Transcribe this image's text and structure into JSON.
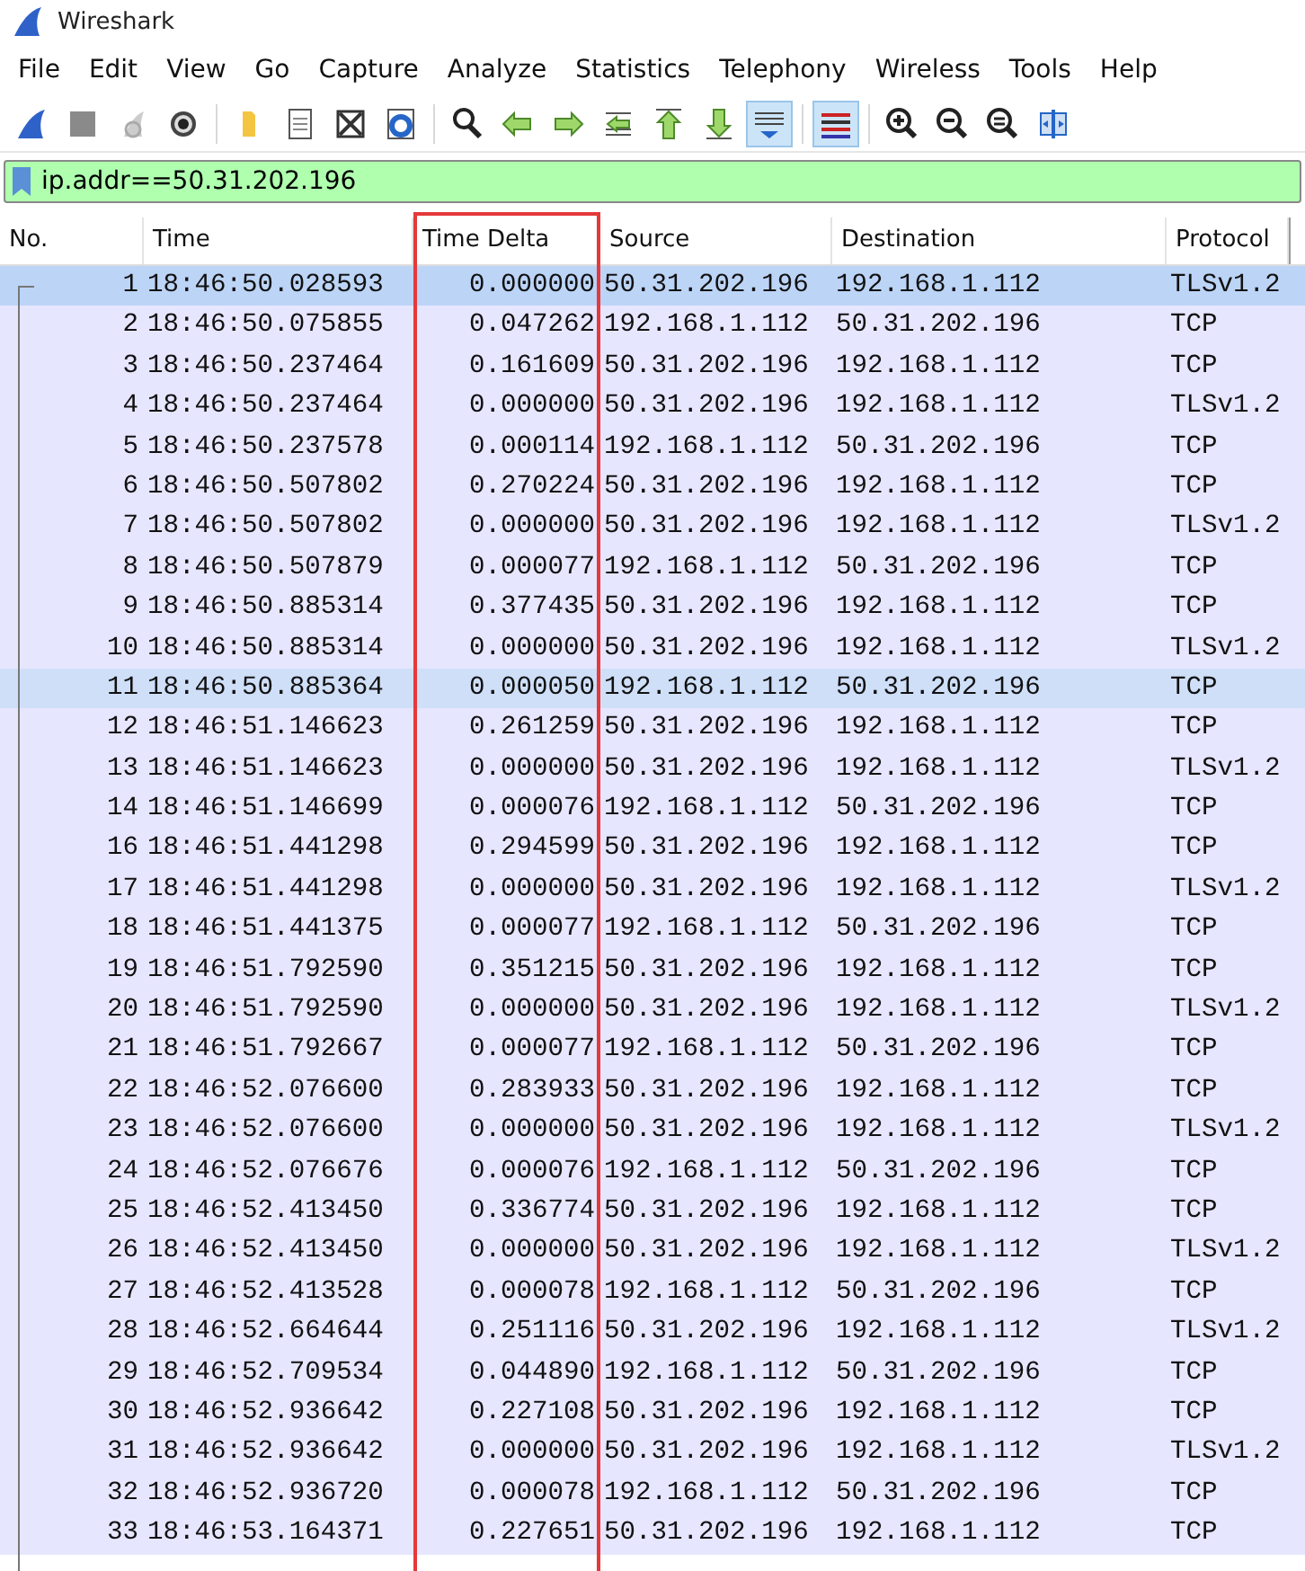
{
  "window": {
    "title": "Wireshark"
  },
  "menu": [
    "File",
    "Edit",
    "View",
    "Go",
    "Capture",
    "Analyze",
    "Statistics",
    "Telephony",
    "Wireless",
    "Tools",
    "Help"
  ],
  "toolbar": [
    [
      {
        "pressed": false
      },
      {
        "pressed": false
      },
      {
        "pressed": false
      },
      {
        "pressed": false
      }
    ],
    [
      {
        "pressed": false
      },
      {
        "pressed": false
      },
      {
        "pressed": false
      },
      {
        "pressed": false
      }
    ],
    [
      {
        "pressed": false
      },
      {
        "pressed": false
      },
      {
        "pressed": false
      },
      {
        "pressed": false
      },
      {
        "pressed": false
      },
      {
        "pressed": false
      },
      {
        "pressed": true
      }
    ],
    [
      {
        "pressed": true
      }
    ],
    [
      {
        "pressed": false
      },
      {
        "pressed": false
      },
      {
        "pressed": false
      },
      {
        "pressed": false
      }
    ]
  ],
  "filter": {
    "value": "ip.addr==50.31.202.196"
  },
  "table": {
    "columns": [
      {
        "label": "No.",
        "highlighted": false
      },
      {
        "label": "Time",
        "highlighted": false
      },
      {
        "label": "Time Delta",
        "highlighted": true
      },
      {
        "label": "Source",
        "highlighted": false
      },
      {
        "label": "Destination",
        "highlighted": false
      },
      {
        "label": "Protocol",
        "highlighted": false
      }
    ],
    "rows": [
      {
        "cells": [
          "1",
          "18:46:50.028593",
          "0.000000",
          "50.31.202.196",
          "192.168.1.112",
          "TLSv1.2"
        ],
        "selected": true,
        "hovered": false
      },
      {
        "cells": [
          "2",
          "18:46:50.075855",
          "0.047262",
          "192.168.1.112",
          "50.31.202.196",
          "TCP"
        ],
        "selected": false,
        "hovered": false
      },
      {
        "cells": [
          "3",
          "18:46:50.237464",
          "0.161609",
          "50.31.202.196",
          "192.168.1.112",
          "TCP"
        ],
        "selected": false,
        "hovered": false
      },
      {
        "cells": [
          "4",
          "18:46:50.237464",
          "0.000000",
          "50.31.202.196",
          "192.168.1.112",
          "TLSv1.2"
        ],
        "selected": false,
        "hovered": false
      },
      {
        "cells": [
          "5",
          "18:46:50.237578",
          "0.000114",
          "192.168.1.112",
          "50.31.202.196",
          "TCP"
        ],
        "selected": false,
        "hovered": false
      },
      {
        "cells": [
          "6",
          "18:46:50.507802",
          "0.270224",
          "50.31.202.196",
          "192.168.1.112",
          "TCP"
        ],
        "selected": false,
        "hovered": false
      },
      {
        "cells": [
          "7",
          "18:46:50.507802",
          "0.000000",
          "50.31.202.196",
          "192.168.1.112",
          "TLSv1.2"
        ],
        "selected": false,
        "hovered": false
      },
      {
        "cells": [
          "8",
          "18:46:50.507879",
          "0.000077",
          "192.168.1.112",
          "50.31.202.196",
          "TCP"
        ],
        "selected": false,
        "hovered": false
      },
      {
        "cells": [
          "9",
          "18:46:50.885314",
          "0.377435",
          "50.31.202.196",
          "192.168.1.112",
          "TCP"
        ],
        "selected": false,
        "hovered": false
      },
      {
        "cells": [
          "10",
          "18:46:50.885314",
          "0.000000",
          "50.31.202.196",
          "192.168.1.112",
          "TLSv1.2"
        ],
        "selected": false,
        "hovered": false
      },
      {
        "cells": [
          "11",
          "18:46:50.885364",
          "0.000050",
          "192.168.1.112",
          "50.31.202.196",
          "TCP"
        ],
        "selected": false,
        "hovered": true
      },
      {
        "cells": [
          "12",
          "18:46:51.146623",
          "0.261259",
          "50.31.202.196",
          "192.168.1.112",
          "TCP"
        ],
        "selected": false,
        "hovered": false
      },
      {
        "cells": [
          "13",
          "18:46:51.146623",
          "0.000000",
          "50.31.202.196",
          "192.168.1.112",
          "TLSv1.2"
        ],
        "selected": false,
        "hovered": false
      },
      {
        "cells": [
          "14",
          "18:46:51.146699",
          "0.000076",
          "192.168.1.112",
          "50.31.202.196",
          "TCP"
        ],
        "selected": false,
        "hovered": false
      },
      {
        "cells": [
          "16",
          "18:46:51.441298",
          "0.294599",
          "50.31.202.196",
          "192.168.1.112",
          "TCP"
        ],
        "selected": false,
        "hovered": false
      },
      {
        "cells": [
          "17",
          "18:46:51.441298",
          "0.000000",
          "50.31.202.196",
          "192.168.1.112",
          "TLSv1.2"
        ],
        "selected": false,
        "hovered": false
      },
      {
        "cells": [
          "18",
          "18:46:51.441375",
          "0.000077",
          "192.168.1.112",
          "50.31.202.196",
          "TCP"
        ],
        "selected": false,
        "hovered": false
      },
      {
        "cells": [
          "19",
          "18:46:51.792590",
          "0.351215",
          "50.31.202.196",
          "192.168.1.112",
          "TCP"
        ],
        "selected": false,
        "hovered": false
      },
      {
        "cells": [
          "20",
          "18:46:51.792590",
          "0.000000",
          "50.31.202.196",
          "192.168.1.112",
          "TLSv1.2"
        ],
        "selected": false,
        "hovered": false
      },
      {
        "cells": [
          "21",
          "18:46:51.792667",
          "0.000077",
          "192.168.1.112",
          "50.31.202.196",
          "TCP"
        ],
        "selected": false,
        "hovered": false
      },
      {
        "cells": [
          "22",
          "18:46:52.076600",
          "0.283933",
          "50.31.202.196",
          "192.168.1.112",
          "TCP"
        ],
        "selected": false,
        "hovered": false
      },
      {
        "cells": [
          "23",
          "18:46:52.076600",
          "0.000000",
          "50.31.202.196",
          "192.168.1.112",
          "TLSv1.2"
        ],
        "selected": false,
        "hovered": false
      },
      {
        "cells": [
          "24",
          "18:46:52.076676",
          "0.000076",
          "192.168.1.112",
          "50.31.202.196",
          "TCP"
        ],
        "selected": false,
        "hovered": false
      },
      {
        "cells": [
          "25",
          "18:46:52.413450",
          "0.336774",
          "50.31.202.196",
          "192.168.1.112",
          "TCP"
        ],
        "selected": false,
        "hovered": false
      },
      {
        "cells": [
          "26",
          "18:46:52.413450",
          "0.000000",
          "50.31.202.196",
          "192.168.1.112",
          "TLSv1.2"
        ],
        "selected": false,
        "hovered": false
      },
      {
        "cells": [
          "27",
          "18:46:52.413528",
          "0.000078",
          "192.168.1.112",
          "50.31.202.196",
          "TCP"
        ],
        "selected": false,
        "hovered": false
      },
      {
        "cells": [
          "28",
          "18:46:52.664644",
          "0.251116",
          "50.31.202.196",
          "192.168.1.112",
          "TLSv1.2"
        ],
        "selected": false,
        "hovered": false
      },
      {
        "cells": [
          "29",
          "18:46:52.709534",
          "0.044890",
          "192.168.1.112",
          "50.31.202.196",
          "TCP"
        ],
        "selected": false,
        "hovered": false
      },
      {
        "cells": [
          "30",
          "18:46:52.936642",
          "0.227108",
          "50.31.202.196",
          "192.168.1.112",
          "TCP"
        ],
        "selected": false,
        "hovered": false
      },
      {
        "cells": [
          "31",
          "18:46:52.936642",
          "0.000000",
          "50.31.202.196",
          "192.168.1.112",
          "TLSv1.2"
        ],
        "selected": false,
        "hovered": false
      },
      {
        "cells": [
          "32",
          "18:46:52.936720",
          "0.000078",
          "192.168.1.112",
          "50.31.202.196",
          "TCP"
        ],
        "selected": false,
        "hovered": false
      },
      {
        "cells": [
          "33",
          "18:46:53.164371",
          "0.227651",
          "50.31.202.196",
          "192.168.1.112",
          "TCP"
        ],
        "selected": false,
        "hovered": false
      }
    ]
  }
}
